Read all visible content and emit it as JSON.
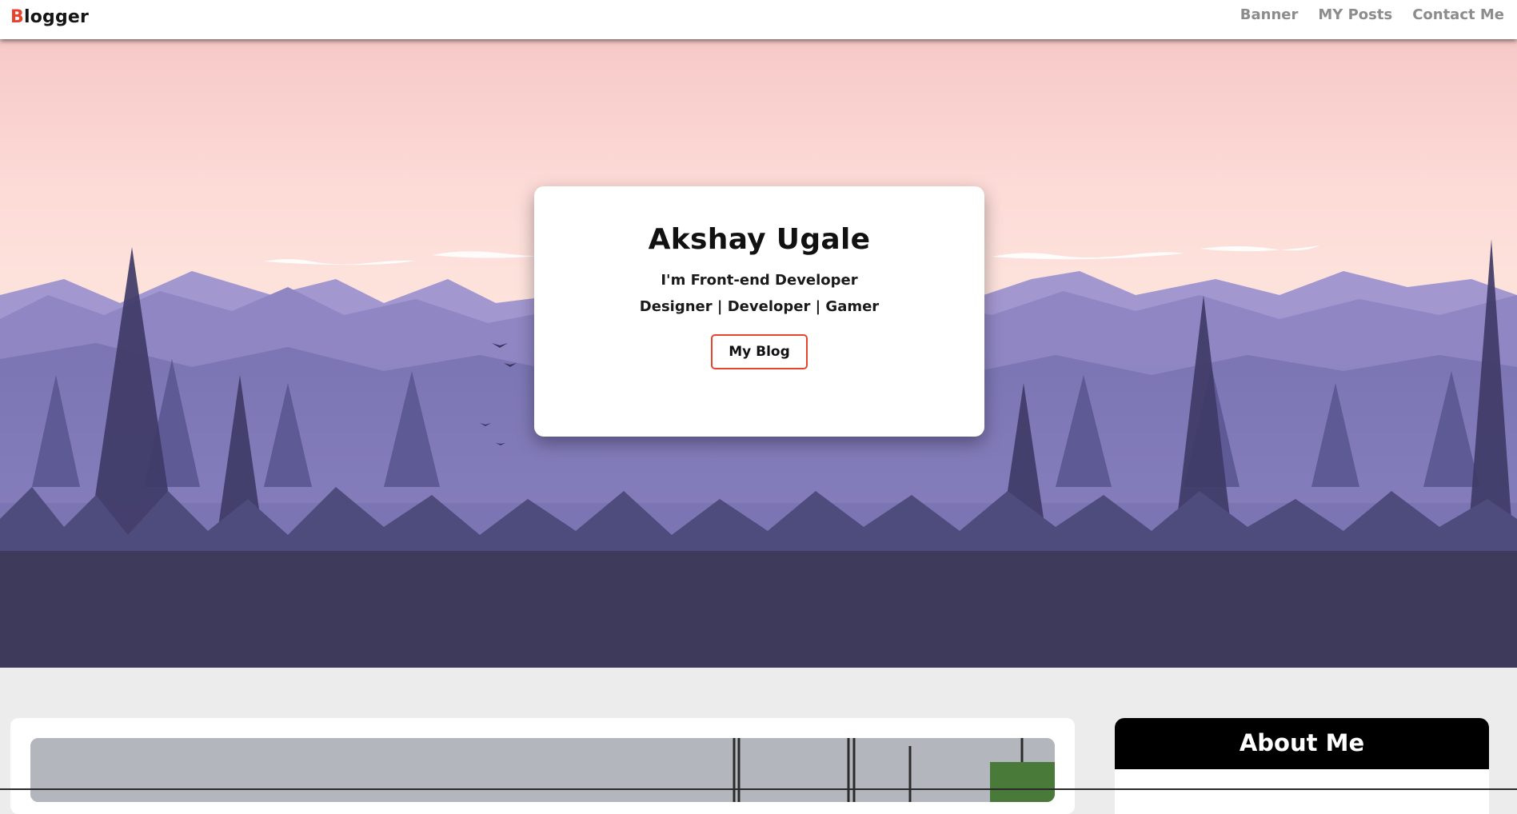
{
  "nav": {
    "brand_first_letter": "B",
    "brand_rest": "logger",
    "links": [
      "Banner",
      "MY Posts",
      "Contact Me"
    ]
  },
  "hero": {
    "name": "Akshay Ugale",
    "role": "I'm Front-end Developer",
    "tags": "Designer | Developer | Gamer",
    "button_label": "My Blog"
  },
  "about": {
    "title": "About Me"
  },
  "colors": {
    "accent": "#e8432d",
    "nav_link": "#8c8c8c",
    "about_header_bg": "#000000"
  }
}
